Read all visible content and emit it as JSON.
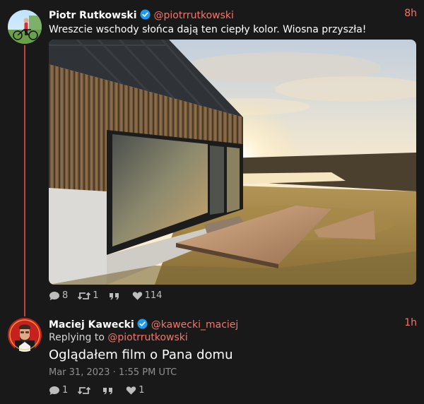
{
  "tweet1": {
    "author_name": "Piotr Rutkowski",
    "handle": "@piotrrutkowski",
    "time": "8h",
    "text": "Wreszcie wschody słońca dają ten ciepły kolor. Wiosna przyszła!",
    "replies": "8",
    "retweets": "1",
    "likes": "114"
  },
  "tweet2": {
    "author_name": "Maciej Kawecki",
    "handle": "@kawecki_maciej",
    "time": "1h",
    "replying_label": "Replying to",
    "replying_handle": "@piotrrutkowski",
    "text": "Oglądałem film o Pana domu",
    "date": "Mar 31, 2023 · 1:55 PM UTC",
    "replies": "1",
    "likes": "1"
  },
  "colors": {
    "background": "#191919",
    "accent": "#f5756c",
    "thread_line": "#c3423f",
    "verified": "#1d9bf0"
  }
}
